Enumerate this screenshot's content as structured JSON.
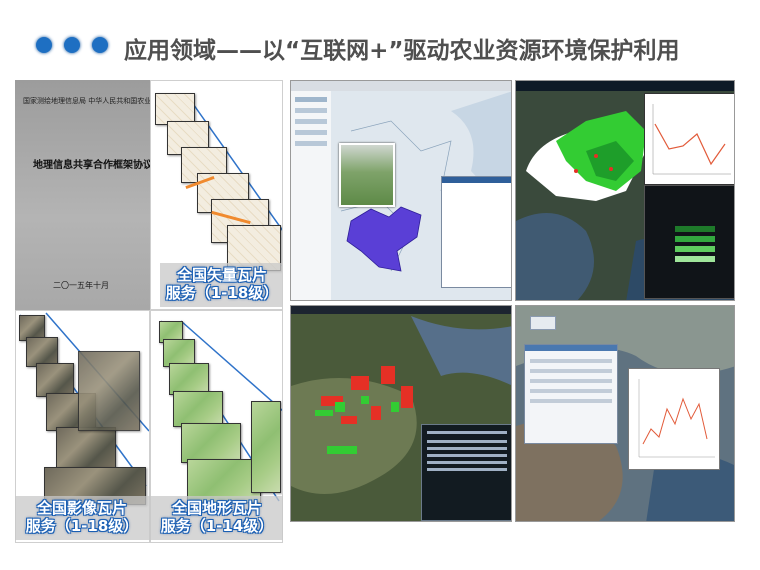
{
  "header": {
    "bullet_icons": [
      "dot-icon",
      "dot-icon",
      "dot-icon"
    ],
    "title": "应用领域——以“互联网+”驱动农业资源环境保护利用"
  },
  "agreement_doc": {
    "header_line": "国家测绘地理信息局  中华人民共和国农业部",
    "title": "地理信息共享合作框架协议",
    "date": "二〇一五年十月"
  },
  "tile_services": {
    "vector": {
      "line1": "全国矢量瓦片",
      "line2": "服务（1-18级）"
    },
    "imagery": {
      "line1": "全国影像瓦片",
      "line2": "服务（1-18级）"
    },
    "terrain": {
      "line1": "全国地形瓦片",
      "line2": "服务（1-14级）"
    }
  },
  "colors": {
    "bullet": "#1e6fc2",
    "title_text": "#4f4f4f",
    "caption_outline": "#1a5fb4",
    "region_purple": "#5a3fd6",
    "region_green": "#33cc33",
    "hotspot_red": "#e53025",
    "line_chart": "#e25b3a"
  }
}
